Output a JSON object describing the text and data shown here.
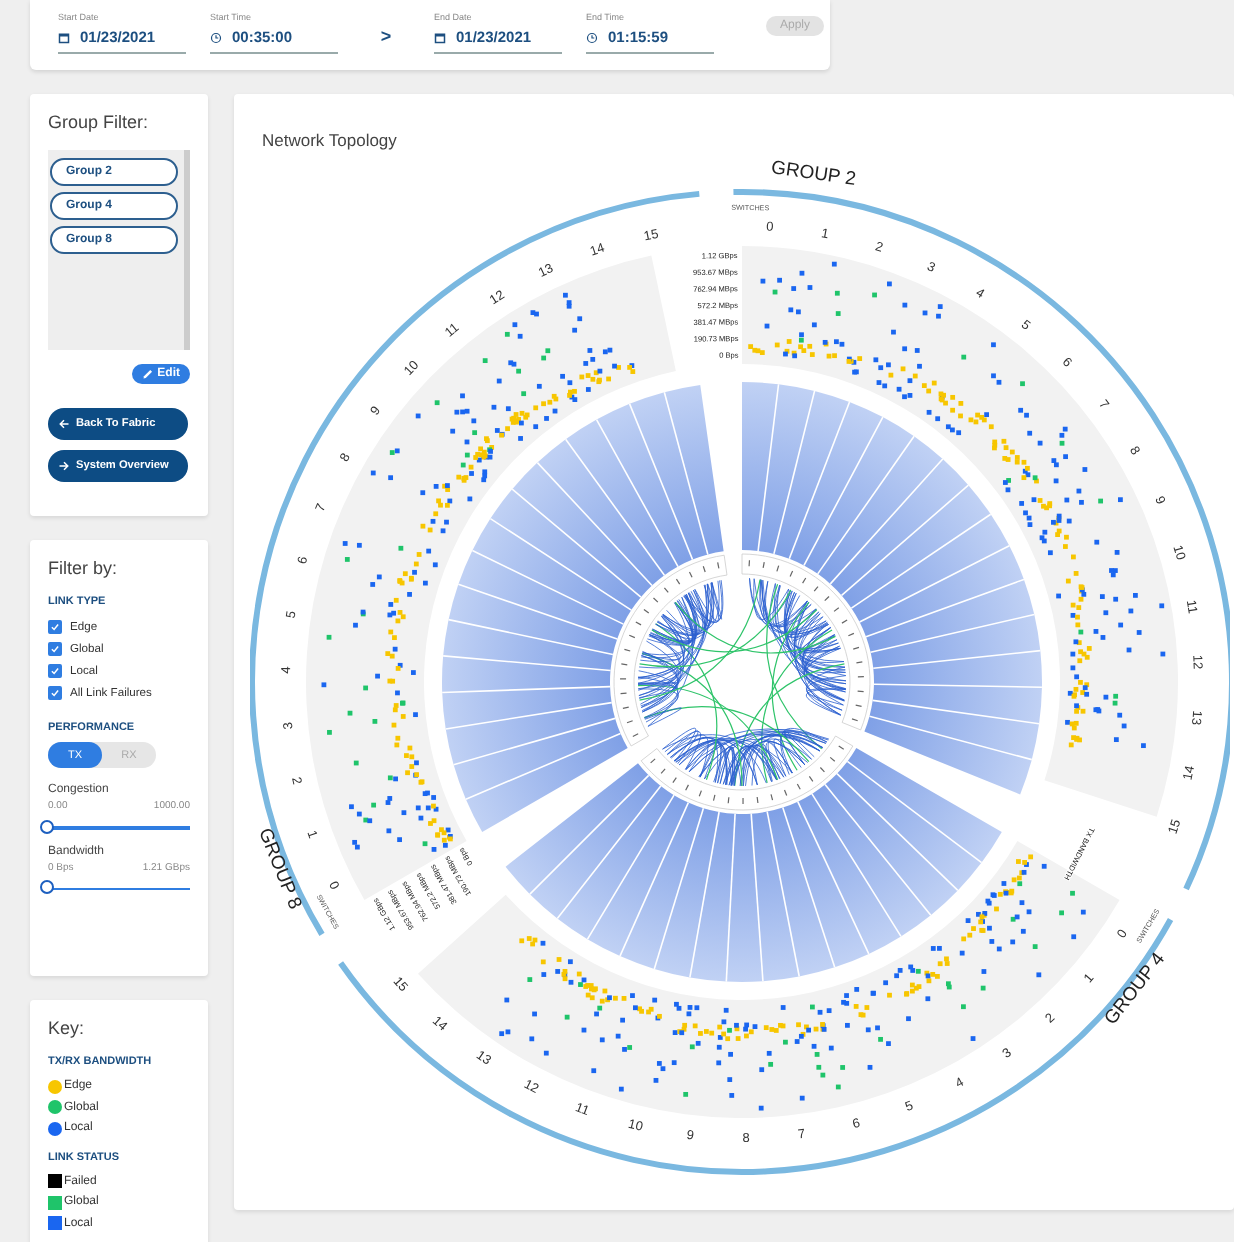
{
  "time_range": {
    "fields": [
      {
        "kind": "date",
        "label": "Start Date",
        "value": "01/23/2021"
      },
      {
        "kind": "time",
        "label": "Start Time",
        "value": "00:35:00"
      },
      {
        "kind": "separator",
        "value": ">"
      },
      {
        "kind": "date",
        "label": "End Date",
        "value": "01/23/2021"
      },
      {
        "kind": "time",
        "label": "End Time",
        "value": "01:15:59"
      }
    ],
    "apply": {
      "label": "Apply",
      "disabled": true
    }
  },
  "group_filter": {
    "title": "Group Filter:",
    "groups": [
      "Group 2",
      "Group 4",
      "Group 8"
    ],
    "edit": "Edit",
    "buttons": [
      {
        "label": "Back To Fabric",
        "kind": "back"
      },
      {
        "label": "System Overview",
        "kind": "forward"
      }
    ]
  },
  "filter": {
    "title": "Filter by:",
    "link_type": {
      "heading": "LINK TYPE",
      "options": [
        {
          "label": "Edge",
          "checked": true
        },
        {
          "label": "Global",
          "checked": true
        },
        {
          "label": "Local",
          "checked": true
        },
        {
          "label": "All Link Failures",
          "checked": true
        }
      ]
    },
    "performance": {
      "heading": "PERFORMANCE",
      "tabs": [
        {
          "label": "TX",
          "selected": true
        },
        {
          "label": "RX",
          "selected": false
        }
      ]
    },
    "sliders": [
      {
        "label": "Congestion",
        "min": "0.00",
        "max": "1000.00",
        "level": 0
      },
      {
        "label": "Bandwidth",
        "min": "0 Bps",
        "max": "1.21 GBps",
        "level": 0
      }
    ]
  },
  "key": {
    "title": "Key:",
    "sections": [
      {
        "heading": "TX/RX BANDWIDTH",
        "items": [
          {
            "kind": "dot",
            "label": "Edge",
            "color": "#f7c600"
          },
          {
            "kind": "dot",
            "label": "Global",
            "color": "#1fc46a"
          },
          {
            "kind": "dot",
            "label": "Local",
            "color": "#1a66f0"
          }
        ]
      },
      {
        "heading": "LINK STATUS",
        "items": [
          {
            "kind": "square",
            "label": "Failed",
            "color": "#000000"
          },
          {
            "kind": "square",
            "label": "Global",
            "color": "#1fc46a"
          },
          {
            "kind": "square",
            "label": "Local",
            "color": "#1a66f0"
          }
        ]
      }
    ]
  },
  "topology": {
    "title": "Network Topology",
    "groups": [
      {
        "name": "GROUP 2",
        "axis_title": "SWITCHES",
        "switches": [
          "0",
          "1",
          "2",
          "3",
          "4",
          "5",
          "6",
          "7",
          "8",
          "9",
          "10",
          "11",
          "12",
          "13",
          "14",
          "15"
        ],
        "kind": "ticks",
        "bandwidth_ticks": [
          "1.12 GBps",
          "953.67 MBps",
          "762.94 MBps",
          "572.2 MBps",
          "381.47 MBps",
          "190.73 MBps",
          "0 Bps"
        ]
      },
      {
        "name": "GROUP 4",
        "axis_title": "SWITCHES",
        "switches": [
          "0",
          "1",
          "2",
          "3",
          "4",
          "5",
          "6",
          "7",
          "8",
          "9",
          "10",
          "11",
          "12",
          "13",
          "14",
          "15"
        ],
        "kind": "title",
        "bandwidth_title": "TX BANDWIDTH"
      },
      {
        "name": "GROUP 8",
        "axis_title": "SWITCHES",
        "switches": [
          "0",
          "1",
          "2",
          "3",
          "4",
          "5",
          "6",
          "7",
          "8",
          "9",
          "10",
          "11",
          "12",
          "13",
          "14",
          "15"
        ],
        "kind": "ticks",
        "bandwidth_ticks": [
          "1.12 GBps",
          "953.67 MBps",
          "762.94 MBps",
          "572.2 MBps",
          "381.47 MBps",
          "190.73 MBps",
          "0 Bps"
        ]
      }
    ]
  }
}
